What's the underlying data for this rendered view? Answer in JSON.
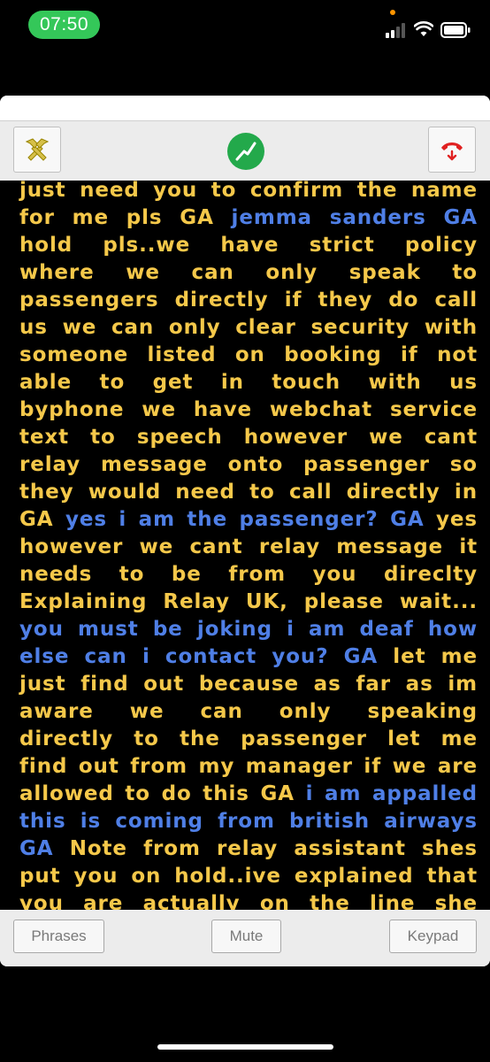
{
  "status_bar": {
    "time": "07:50"
  },
  "toolbar": {
    "settings_icon": "tools-icon",
    "status_icon": "connection-status-icon",
    "hangup_icon": "hangup-icon",
    "colors": {
      "status_green": "#23a94b",
      "hangup_red": "#e02020"
    }
  },
  "transcript": {
    "colors": {
      "other_party": "#f5c84a",
      "user": "#4f7fe6"
    },
    "segments": [
      {
        "speaker": "other",
        "text": "just need you to confirm the name for me pls GA "
      },
      {
        "speaker": "user",
        "text": "jemma sanders GA "
      },
      {
        "speaker": "other",
        "text": "hold pls..we have strict policy where we can only speak to passengers directly if they do call us we can only clear security with someone listed on booking if not able to get in touch with us byphone we have webchat service text to speech however we cant relay message onto passenger so they would need to call directly in GA "
      },
      {
        "speaker": "user",
        "text": "yes i am the passenger? GA "
      },
      {
        "speaker": "other",
        "text": "yes however we cant relay message it needs to be from you direclty Explaining Relay UK, please wait... "
      },
      {
        "speaker": "user",
        "text": "you must be joking i am deaf how else can i contact you? GA "
      },
      {
        "speaker": "other",
        "text": "let me just find out because as far as im aware we can only speaking directly to the passenger let me find out from my manager if we are allowed to do this GA "
      },
      {
        "speaker": "user",
        "text": "i am appalled this is coming from british airways GA "
      },
      {
        "speaker": "other",
        "text": "Note from relay assistant shes put you on hold..ive explained that you are actually on the line she just repeated the same thing we"
      }
    ]
  },
  "bottom_bar": {
    "phrases_label": "Phrases",
    "mute_label": "Mute",
    "keypad_label": "Keypad"
  }
}
